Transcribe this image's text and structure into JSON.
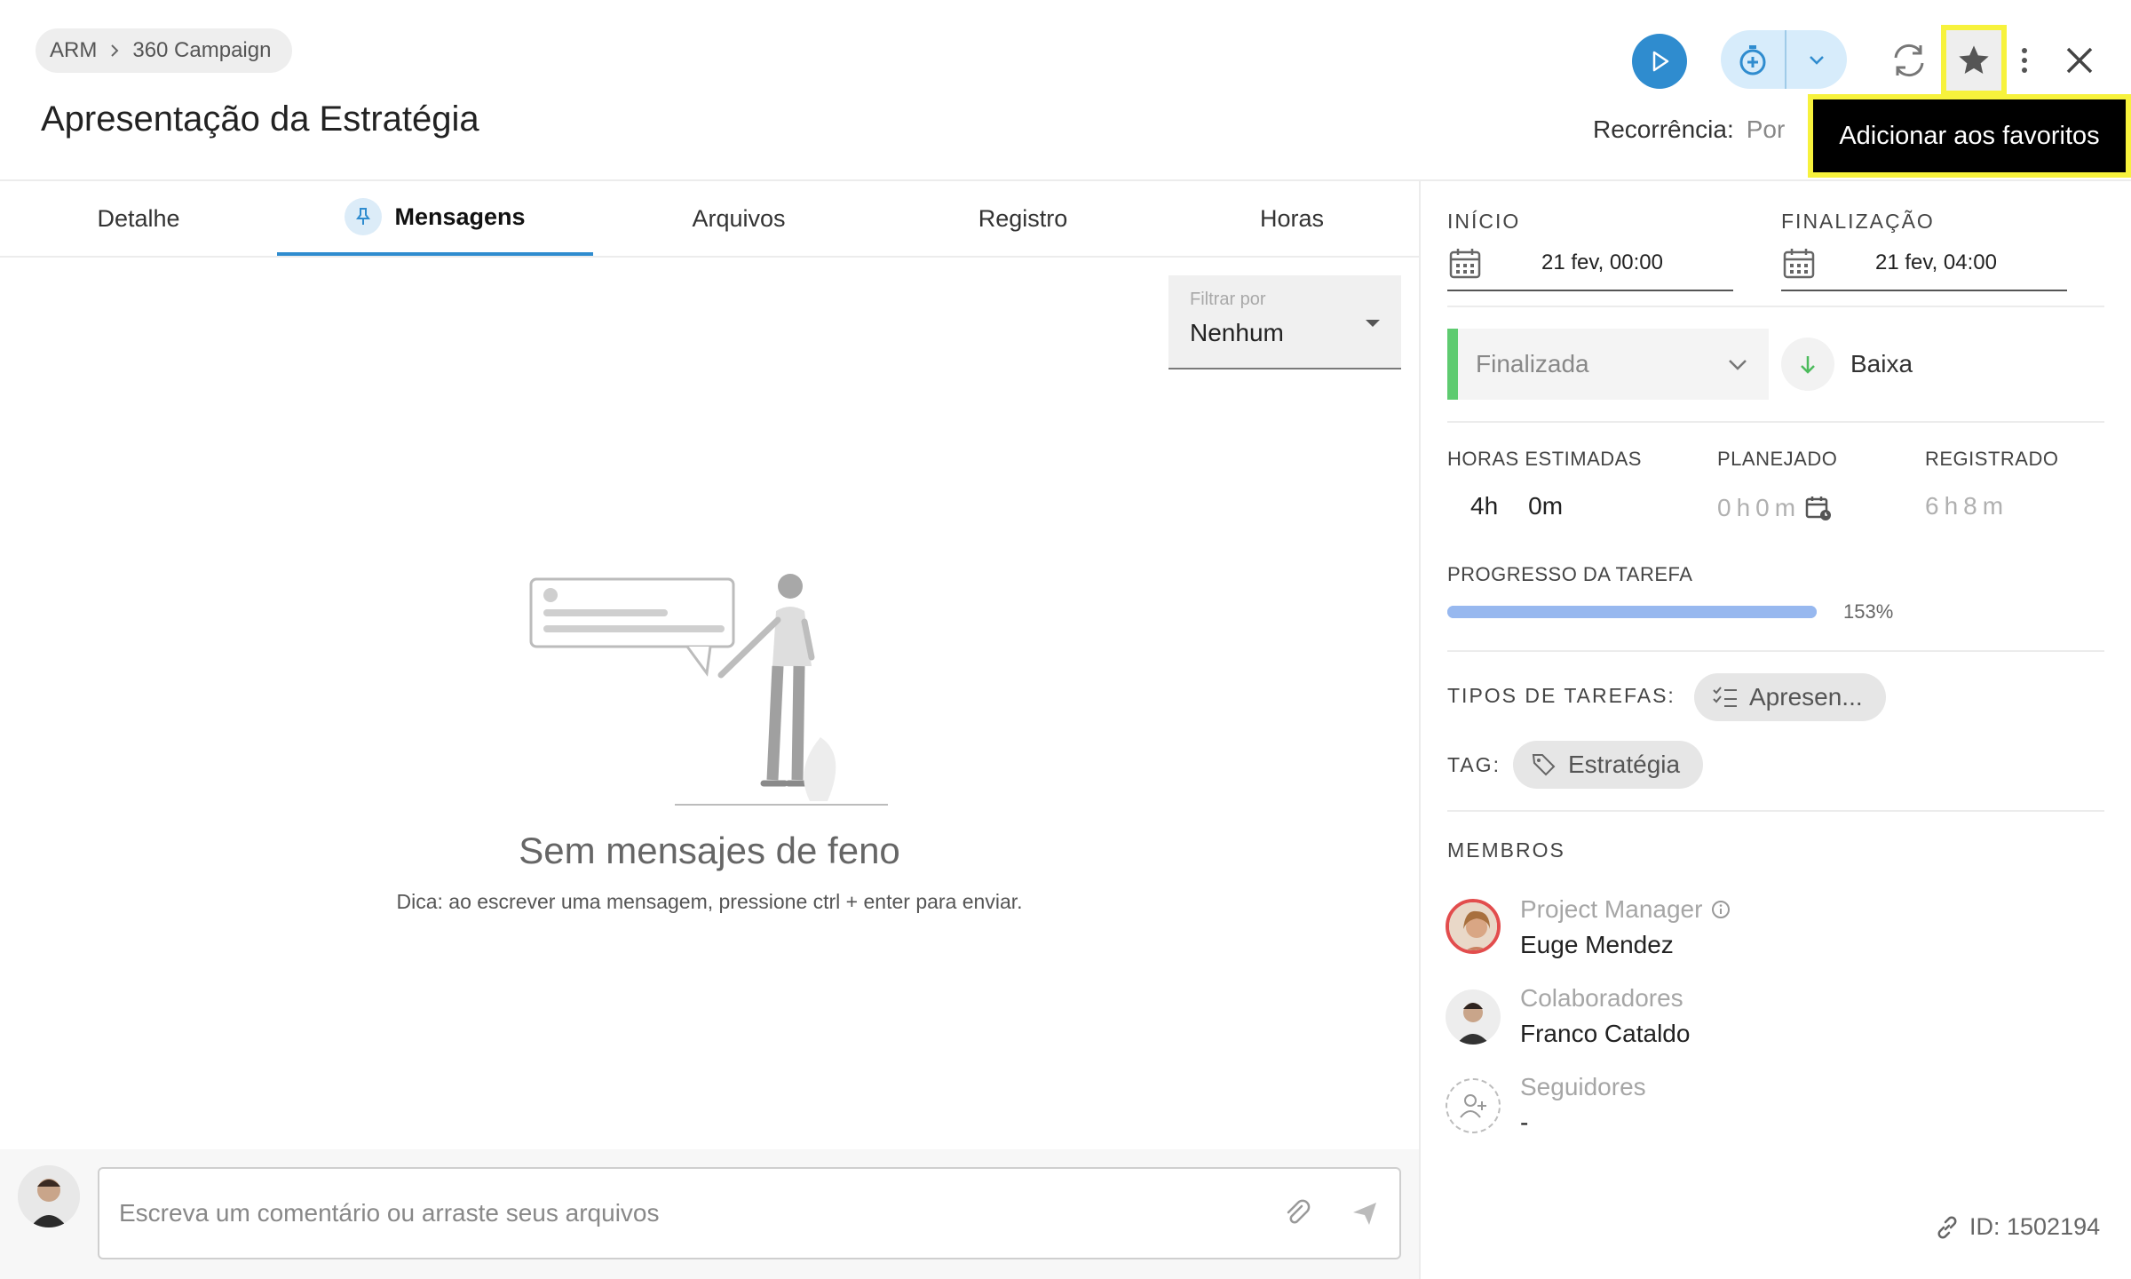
{
  "header": {
    "breadcrumb": [
      "ARM",
      "360 Campaign"
    ],
    "title": "Apresentação da Estratégia",
    "recurrence_label": "Recorrência:",
    "recurrence_value": "Por",
    "tooltip": "Adicionar aos favoritos"
  },
  "tabs": [
    {
      "label": "Detalhe",
      "active": false
    },
    {
      "label": "Mensagens",
      "active": true
    },
    {
      "label": "Arquivos",
      "active": false
    },
    {
      "label": "Registro",
      "active": false
    },
    {
      "label": "Horas",
      "active": false
    }
  ],
  "filter": {
    "label": "Filtrar por",
    "value": "Nenhum"
  },
  "empty_state": {
    "title": "Sem mensajes de feno",
    "hint": "Dica: ao escrever uma mensagem, pressione ctrl + enter para enviar."
  },
  "comment": {
    "placeholder": "Escreva um comentário ou arraste seus arquivos"
  },
  "details": {
    "start_label": "INÍCIO",
    "start_value": "21 fev, 00:00",
    "end_label": "FINALIZAÇÃO",
    "end_value": "21 fev, 04:00",
    "status": "Finalizada",
    "priority": "Baixa",
    "estimated_label": "HORAS ESTIMADAS",
    "estimated_hours": "4h",
    "estimated_minutes": "0m",
    "planned_label": "PLANEJADO",
    "planned_value": "0h0m",
    "registered_label": "REGISTRADO",
    "registered_value": "6h8m",
    "progress_label": "PROGRESSO DA TAREFA",
    "progress_text": "153%",
    "progress_fraction": 1.0,
    "task_types_label": "TIPOS DE TAREFAS:",
    "task_type": "Apresen...",
    "tag_label": "TAG:",
    "tag": "Estratégia"
  },
  "members": {
    "title": "MEMBROS",
    "list": [
      {
        "role": "Project Manager",
        "name": "Euge Mendez"
      },
      {
        "role": "Colaboradores",
        "name": "Franco Cataldo"
      },
      {
        "role": "Seguidores",
        "name": "-"
      }
    ]
  },
  "footer": {
    "id_text": "ID: 1502194"
  },
  "colors": {
    "accent": "#2f8ccf",
    "status_done": "#5ecb70",
    "progress": "#97b8ef",
    "highlight": "#f7f23c"
  }
}
